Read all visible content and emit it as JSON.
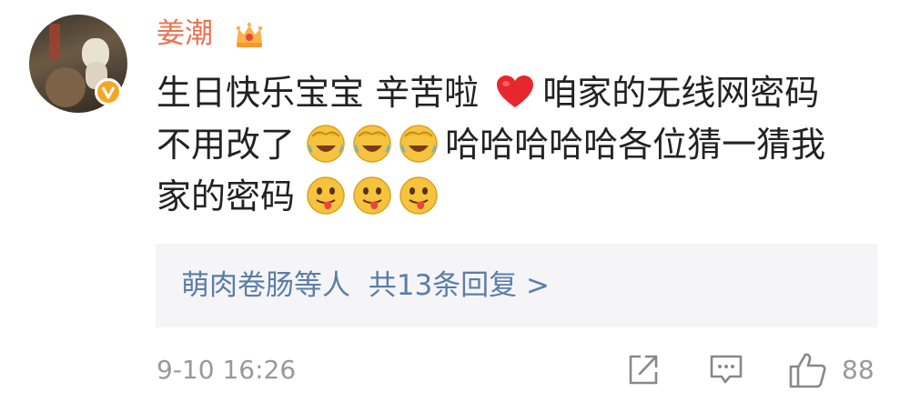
{
  "comment": {
    "author": "姜潮",
    "author_badge_icon": "crown-icon",
    "verified_icon": "verified-v-icon",
    "content_lines": [
      {
        "parts": [
          {
            "t": "text",
            "v": "生日快乐宝宝 辛苦啦"
          },
          {
            "t": "heart"
          },
          {
            "t": "text",
            "v": "咱家的无线网密码"
          }
        ]
      },
      {
        "parts": [
          {
            "t": "text",
            "v": "不用改了"
          },
          {
            "t": "laugh"
          },
          {
            "t": "laugh"
          },
          {
            "t": "laugh"
          },
          {
            "t": "text",
            "v": "哈哈哈哈哈各位猜一猜我"
          }
        ]
      },
      {
        "parts": [
          {
            "t": "text",
            "v": "家的密码"
          },
          {
            "t": "tongue"
          },
          {
            "t": "tongue"
          },
          {
            "t": "tongue"
          }
        ]
      }
    ],
    "line1_a": "生日快乐宝宝 辛苦啦",
    "line1_b": "咱家的无线网密码",
    "line2_a": "不用改了",
    "line2_b": "哈哈哈哈哈各位猜一猜我",
    "line3_a": "家的密码",
    "emojis": {
      "heart": "red-heart-icon",
      "laugh": "laugh-cry-emoji-icon",
      "tongue": "tongue-out-emoji-icon"
    },
    "replies": {
      "people": "萌肉卷肠等人",
      "total_label": "共13条回复",
      "arrow": ">"
    },
    "timestamp": "9-10 16:26",
    "actions": {
      "share_icon": "share-icon",
      "comment_icon": "comment-icon",
      "like_icon": "thumbs-up-icon",
      "like_count": "88"
    },
    "colors": {
      "author": "#eb7350",
      "link": "#5b7da8",
      "meta": "#999999",
      "reply_bg": "#f5f5f7",
      "verified": "#f6a623"
    }
  }
}
